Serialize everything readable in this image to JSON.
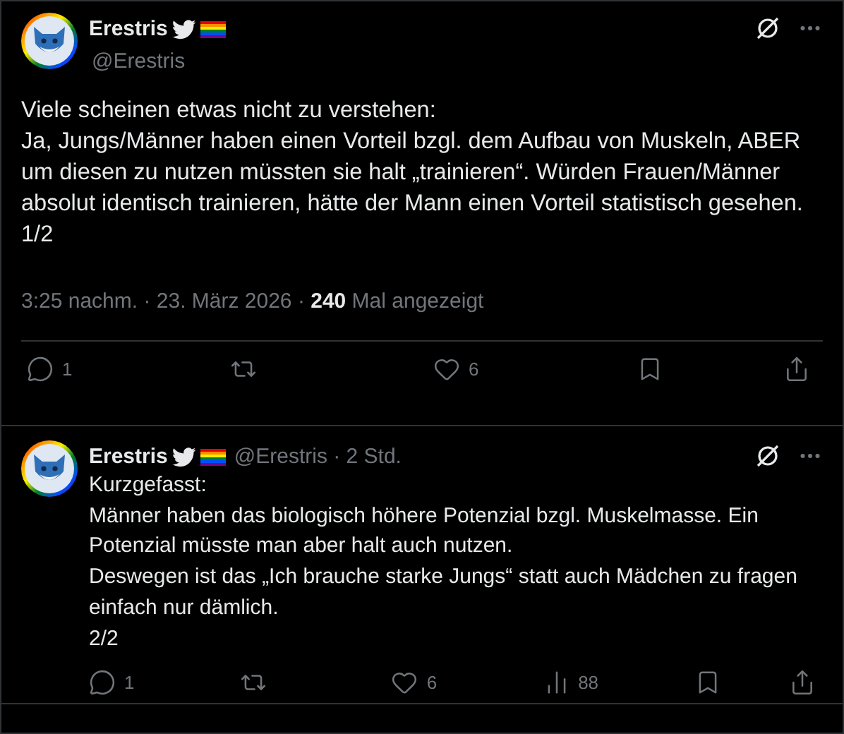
{
  "posts": [
    {
      "kind": "main",
      "author": {
        "name": "Erestris",
        "handle": "@Erestris"
      },
      "text": "Viele scheinen etwas nicht zu verstehen:\nJa, Jungs/Männer haben einen Vorteil bzgl. dem Aufbau von Muskeln, ABER um diesen zu nutzen müssten sie halt „trainieren“. Würden Frauen/Männer absolut identisch trainieren, hätte der Mann einen Vorteil statistisch gesehen.\n1/2",
      "meta": "3:25 nachm. · 23. März 2026 · **240** Mal angezeigt",
      "actions": [
        {
          "kind": "reply",
          "count": "1"
        },
        {
          "kind": "repost"
        },
        {
          "kind": "like",
          "count": "6"
        },
        {
          "kind": "bookmark"
        },
        {
          "kind": "share"
        }
      ]
    },
    {
      "kind": "reply",
      "author": {
        "name": "Erestris",
        "handle": "@Erestris · 2 Std."
      },
      "text": "Kurzgefasst:\nMänner haben das biologisch höhere Potenzial bzgl. Muskelmasse. Ein Potenzial müsste man aber halt auch nutzen.\nDeswegen ist das „Ich brauche starke Jungs“ statt auch Mädchen zu fragen einfach nur dämlich.\n2/2",
      "actions": [
        {
          "kind": "reply",
          "count": "1"
        },
        {
          "kind": "repost"
        },
        {
          "kind": "like",
          "count": "6"
        },
        {
          "kind": "views",
          "count": "88"
        },
        {
          "kind": "bookmark"
        },
        {
          "kind": "share"
        }
      ]
    }
  ]
}
